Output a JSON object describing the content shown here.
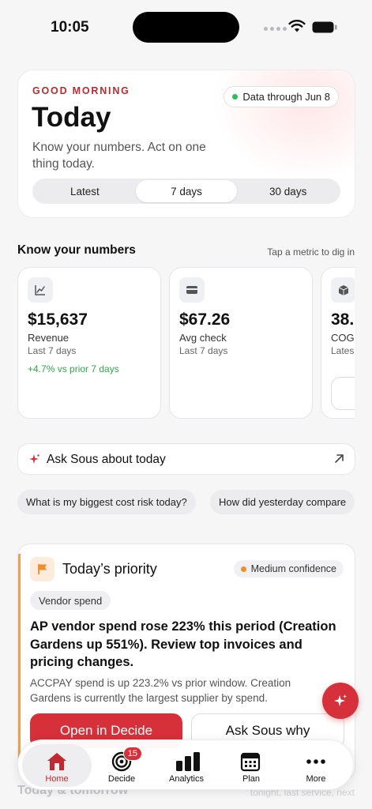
{
  "status_bar": {
    "time": "10:05"
  },
  "hero": {
    "greeting": "GOOD MORNING",
    "title": "Today",
    "subtitle": "Know your numbers. Act on one thing today.",
    "data_pill": "Data through Jun 8",
    "ranges": [
      "Latest",
      "7 days",
      "30 days"
    ],
    "selected_range": "7 days"
  },
  "numbers": {
    "title": "Know your numbers",
    "hint": "Tap a metric to dig in",
    "metrics": [
      {
        "icon": "chart-icon",
        "value": "$15,637",
        "label": "Revenue",
        "period": "Last 7 days",
        "delta": "+4.7% vs prior 7 days"
      },
      {
        "icon": "card-icon",
        "value": "$67.26",
        "label": "Avg check",
        "period": "Last 7 days",
        "delta": ""
      },
      {
        "icon": "box-icon",
        "value": "38.",
        "label": "COG",
        "period": "Lates",
        "delta": ""
      }
    ]
  },
  "ask": {
    "label": "Ask Sous about today",
    "chips": [
      "What is my biggest cost risk today?",
      "How did yesterday compare"
    ]
  },
  "priority": {
    "title": "Today’s priority",
    "confidence": "Medium confidence",
    "tag": "Vendor spend",
    "headline": "AP vendor spend rose 223% this period (Creation Gardens up 551%). Review top invoices and pricing changes.",
    "body": "ACCPAY spend is up 223.2% vs prior window. Creation Gardens is currently the largest supplier by spend.",
    "primary_button": "Open in Decide",
    "secondary_button": "Ask Sous why"
  },
  "next_section": {
    "title": "Today & tomorrow",
    "hint": "tonight, last service, next"
  },
  "tabbar": {
    "tabs": [
      {
        "label": "Home",
        "icon": "home-icon"
      },
      {
        "label": "Decide",
        "icon": "target-icon",
        "badge": "15"
      },
      {
        "label": "Analytics",
        "icon": "bar-chart-icon"
      },
      {
        "label": "Plan",
        "icon": "calendar-icon"
      },
      {
        "label": "More",
        "icon": "more-icon"
      }
    ],
    "active": "Home"
  },
  "colors": {
    "accent_red": "#d6303a",
    "greeting_red": "#c0292f",
    "positive_green": "#2eaa4a",
    "priority_orange": "#f0a04b"
  }
}
